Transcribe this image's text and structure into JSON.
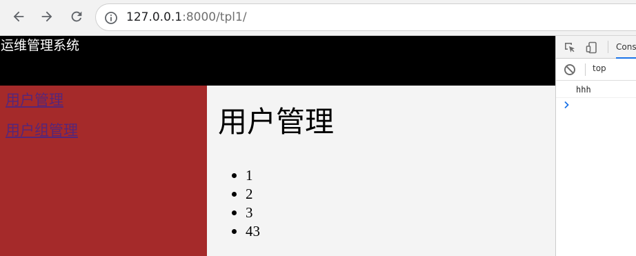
{
  "browser": {
    "url_host": "127.0.0.1",
    "url_rest": ":8000/tpl1/"
  },
  "page": {
    "site_title": "运维管理系统",
    "sidebar": {
      "links": [
        "用户管理",
        "用户组管理"
      ]
    },
    "content": {
      "title": "用户管理",
      "items": [
        "1",
        "2",
        "3",
        "43"
      ]
    },
    "colors": {
      "header_bg": "#000000",
      "sidebar_bg": "#a52a2a",
      "content_bg": "#f4f4f4",
      "link_color": "#55267a"
    }
  },
  "devtools": {
    "active_tab": "Console",
    "context": "top",
    "console_messages": [
      "hhh"
    ]
  }
}
